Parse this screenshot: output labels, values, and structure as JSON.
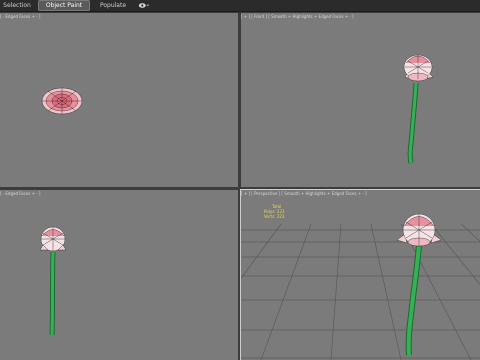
{
  "toolbar": {
    "tabs": [
      {
        "label": "Selection"
      },
      {
        "label": "Object Paint"
      },
      {
        "label": "Populate"
      }
    ],
    "eye_icon": "eye-icon"
  },
  "viewports": {
    "top_left": {
      "label": "[ · Edged Faces + · ] "
    },
    "top_right": {
      "label": "[ + ] [ Front ] [ Smooth + Highlights + Edged Faces + · ] "
    },
    "bottom_left": {
      "label": "[ · Edged Faces + · ] "
    },
    "bottom_right": {
      "label": "[ + ] [ Perspective ] [ Smooth + Highlights + Edged Faces + · ] "
    }
  },
  "stats": {
    "total_label": "Total",
    "polys_label": "Polys:",
    "polys_value": "223",
    "verts_label": "Verts:",
    "verts_value": "223"
  },
  "colors": {
    "viewport_bg": "#7b7b7b",
    "petal": "#e8a8b0",
    "stem": "#2f9a4a",
    "wire": "#1a1a1a"
  }
}
